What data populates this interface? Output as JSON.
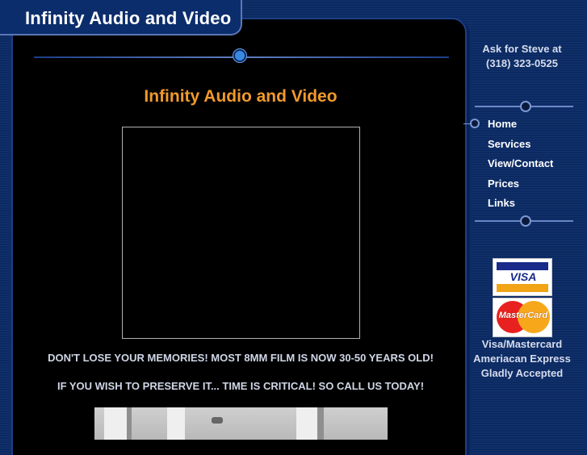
{
  "site": {
    "title": "Infinity Audio and Video"
  },
  "main": {
    "heading": "Infinity Audio and Video",
    "notice_1": "DON'T LOSE YOUR MEMORIES! MOST 8MM FILM IS NOW 30-50 YEARS OLD!",
    "notice_2": "IF YOU WISH TO PRESERVE IT... TIME IS CRITICAL! SO CALL US TODAY!"
  },
  "sidebar": {
    "contact_line_1": "Ask for Steve at",
    "contact_line_2": "(318) 323-0525",
    "nav": [
      {
        "label": "Home",
        "active": true
      },
      {
        "label": "Services"
      },
      {
        "label": "View/Contact"
      },
      {
        "label": "Prices"
      },
      {
        "label": "Links"
      }
    ],
    "visa_logo_text": "VISA",
    "mastercard_logo_text": "MasterCard",
    "cards_line_1": "Visa/Mastercard",
    "cards_line_2": "Ameriacan Express",
    "cards_line_3": "Gladly Accepted"
  },
  "colors": {
    "page_background": "#0b2a63",
    "heading": "#f09a2c",
    "content_background": "#000000"
  }
}
